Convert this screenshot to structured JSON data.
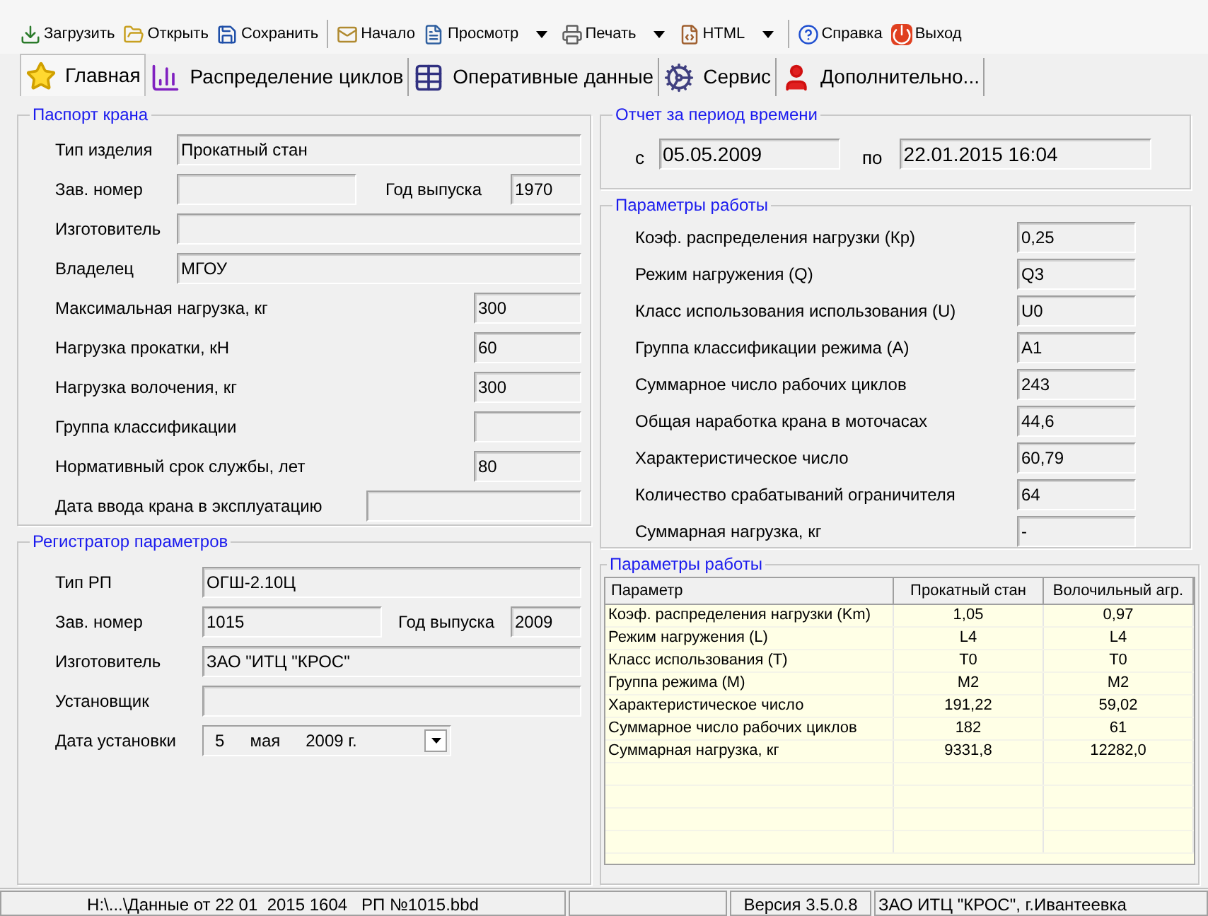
{
  "toolbar": [
    {
      "label": "Загрузить",
      "has_menu": false
    },
    {
      "label": "Открыть",
      "has_menu": false
    },
    {
      "label": "Сохранить",
      "has_menu": false
    },
    {
      "label": "Начало",
      "has_menu": false
    },
    {
      "label": "Просмотр",
      "has_menu": true
    },
    {
      "label": "Печать",
      "has_menu": true
    },
    {
      "label": "HTML",
      "has_menu": true
    },
    {
      "label": "Справка",
      "has_menu": false
    },
    {
      "label": "Выход",
      "has_menu": false
    }
  ],
  "tabs": [
    {
      "label": "Главная",
      "selected": true
    },
    {
      "label": "Распределение циклов",
      "selected": false
    },
    {
      "label": "Оперативные данные",
      "selected": false
    },
    {
      "label": "Сервис",
      "selected": false
    },
    {
      "label": "Дополнительно...",
      "selected": false
    }
  ],
  "passport": {
    "title": "Паспорт крана",
    "rows": [
      {
        "kind": "wide",
        "label": "Тип изделия",
        "value": "Прокатный стан"
      },
      {
        "kind": "pair",
        "label": "Зав. номер",
        "label2": "Год выпуска",
        "value2": "1970"
      },
      {
        "kind": "wide",
        "label": "Изготовитель"
      },
      {
        "kind": "wide",
        "label": "Владелец",
        "value": "МГОУ"
      },
      {
        "kind": "short",
        "label": "Максимальная нагрузка, кг",
        "value": "300"
      },
      {
        "kind": "short",
        "label": "Нагрузка прокатки, кН",
        "value": "60"
      },
      {
        "kind": "short",
        "label": "Нагрузка волочения, кг",
        "value": "300"
      },
      {
        "kind": "short",
        "label": "Группа классификации"
      },
      {
        "kind": "short",
        "label": "Нормативный срок службы, лет",
        "value": "80"
      },
      {
        "kind": "medium",
        "label": "Дата ввода крана в эксплуатацию"
      }
    ]
  },
  "recorder": {
    "title": "Регистратор параметров",
    "rows": [
      {
        "kind": "wide",
        "label": "Тип РП",
        "value": "ОГШ-2.10Ц"
      },
      {
        "kind": "pair",
        "label": "Зав. номер",
        "value": "1015",
        "label2": "Год выпуска",
        "value2": "2009"
      },
      {
        "kind": "wide",
        "label": "Изготовитель",
        "value": "ЗАО \"ИТЦ \"КРОС\""
      },
      {
        "kind": "wide",
        "label": "Установщик"
      },
      {
        "kind": "date",
        "label": "Дата установки",
        "day": "5",
        "month": "мая",
        "year": "2009 г."
      }
    ]
  },
  "report": {
    "title": "Отчет за период времени",
    "from_label": "с",
    "from": "05.05.2009",
    "to_label": "по",
    "to": "22.01.2015 16:04"
  },
  "work": {
    "title": "Параметры работы",
    "rows": [
      {
        "label": "Коэф. распределения нагрузки (Кр)",
        "value": "0,25"
      },
      {
        "label": "Режим нагружения (Q)",
        "value": "Q3"
      },
      {
        "label": "Класс использования использования (U)",
        "value": "U0"
      },
      {
        "label": "Группа классификации режима (А)",
        "value": "А1"
      },
      {
        "label": "Суммарное число рабочих циклов",
        "value": "243"
      },
      {
        "label": "Общая наработка крана в моточасах",
        "value": "44,6"
      },
      {
        "label": "Характеристическое число",
        "value": "60,79"
      },
      {
        "label": "Количество срабатываний ограничителя",
        "value": "64"
      },
      {
        "label": "Суммарная нагрузка, кг",
        "value": "-"
      }
    ]
  },
  "table": {
    "title": "Параметры работы",
    "columns": [
      "Параметр",
      "Прокатный стан",
      "Волочильный агр."
    ],
    "rows": [
      [
        "Коэф. распределения нагрузки (Km)",
        "1,05",
        "0,97"
      ],
      [
        "Режим нагружения (L)",
        "L4",
        "L4"
      ],
      [
        "Класс использования (T)",
        "T0",
        "T0"
      ],
      [
        "Группа режима (M)",
        "M2",
        "M2"
      ],
      [
        "Характеристическое число",
        "191,22",
        "59,02"
      ],
      [
        "Суммарное число рабочих циклов",
        "182",
        "61"
      ],
      [
        "Суммарная нагрузка, кг",
        "9331,8",
        "12282,0"
      ]
    ]
  },
  "status_bar": {
    "file": "H:\\...\\Данные от 22 01  2015 1604   РП №1015.bbd",
    "version": "Версия 3.5.0.8",
    "company": "ЗАО ИТЦ \"КРОС\", г.Ивантеевка"
  }
}
